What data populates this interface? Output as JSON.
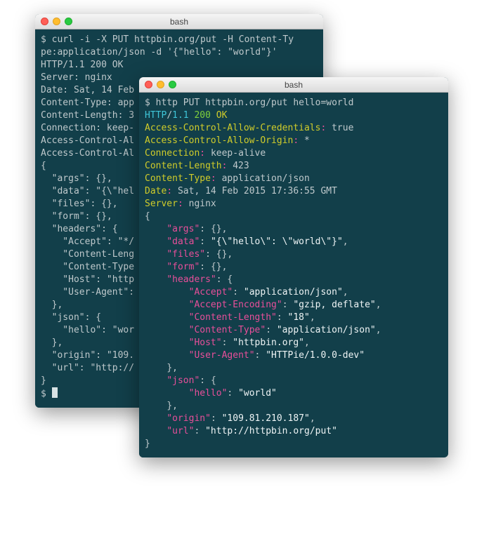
{
  "win1": {
    "title": "bash",
    "prompt": "$ ",
    "cmd1": "curl -i -X PUT httpbin.org/put -H Content-Ty",
    "cmd2": "pe:application/json -d '{\"hello\": \"world\"}'",
    "status": "HTTP/1.1 200 OK",
    "h1": "Server: nginx",
    "h2": "Date: Sat, 14 Feb",
    "h3": "Content-Type: app",
    "h4": "Content-Length: 3",
    "h5": "Connection: keep-",
    "h6": "Access-Control-Al",
    "h7": "Access-Control-Al",
    "b0": "",
    "b1": "{",
    "b2": "  \"args\": {},",
    "b3": "  \"data\": \"{\\\"hel",
    "b4": "  \"files\": {},",
    "b5": "  \"form\": {},",
    "b6": "  \"headers\": {",
    "b7": "    \"Accept\": \"*/",
    "b8": "    \"Content-Leng",
    "b9": "    \"Content-Type",
    "b10": "    \"Host\": \"http",
    "b11": "    \"User-Agent\":",
    "b12": "  },",
    "b13": "  \"json\": {",
    "b14": "    \"hello\": \"wor",
    "b15": "  },",
    "b16": "  \"origin\": \"109.",
    "b17": "  \"url\": \"http://",
    "b18": "}",
    "b19": "$ "
  },
  "win2": {
    "title": "bash",
    "prompt": "$ ",
    "cmd": "http PUT httpbin.org/put hello=world",
    "proto": "HTTP",
    "slash": "/",
    "ver": "1.1",
    "sp": " ",
    "code": "200",
    "reason": "OK",
    "hk1": "Access-Control-Allow-Credentials",
    "hv1": "true",
    "hk2": "Access-Control-Allow-Origin",
    "hv2": "*",
    "hk3": "Connection",
    "hv3": "keep-alive",
    "hk4": "Content-Length",
    "hv4": "423",
    "hk5": "Content-Type",
    "hv5": "application/json",
    "hk6": "Date",
    "hv6": "Sat, 14 Feb 2015 17:36:55 GMT",
    "hk7": "Server",
    "hv7": "nginx",
    "colon": ":",
    "gap": " ",
    "blank": "",
    "j_open": "{",
    "j_close": "}",
    "i1": "    ",
    "i2": "        ",
    "k_args": "\"args\"",
    "v_args": "{}",
    "comma": ",",
    "k_data": "\"data\"",
    "v_data": "\"{\\\"hello\\\": \\\"world\\\"}\"",
    "k_files": "\"files\"",
    "v_files": "{}",
    "k_form": "\"form\"",
    "v_form": "{}",
    "k_headers": "\"headers\"",
    "obj_open": "{",
    "obj_close": "}",
    "k_accept": "\"Accept\"",
    "v_accept": "\"application/json\"",
    "k_acenc": "\"Accept-Encoding\"",
    "v_acenc": "\"gzip, deflate\"",
    "k_clen": "\"Content-Length\"",
    "v_clen": "\"18\"",
    "k_ctype": "\"Content-Type\"",
    "v_ctype": "\"application/json\"",
    "k_host": "\"Host\"",
    "v_host": "\"httpbin.org\"",
    "k_ua": "\"User-Agent\"",
    "v_ua": "\"HTTPie/1.0.0-dev\"",
    "k_json": "\"json\"",
    "k_hello": "\"hello\"",
    "v_hello": "\"world\"",
    "k_origin": "\"origin\"",
    "v_origin": "\"109.81.210.187\"",
    "k_url": "\"url\"",
    "v_url": "\"http://httpbin.org/put\""
  }
}
